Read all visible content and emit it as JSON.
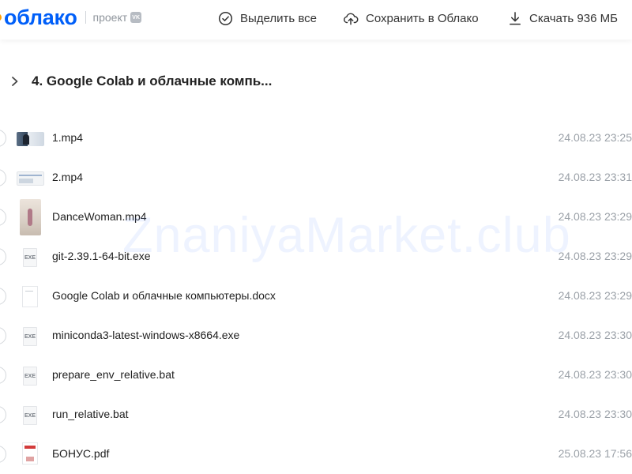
{
  "header": {
    "logo": "облако",
    "project_label": "проект",
    "vk_badge": "VK",
    "actions": {
      "select_all": "Выделить все",
      "save_to_cloud": "Сохранить в Облако",
      "download": "Скачать 936 МБ"
    }
  },
  "folder": {
    "title": "4. Google Colab и облачные компь..."
  },
  "files": [
    {
      "name": "1.mp4",
      "date": "24.08.23 23:25",
      "thumb": "video-thumbnail"
    },
    {
      "name": "2.mp4",
      "date": "24.08.23 23:31",
      "thumb": "video-thumbnail"
    },
    {
      "name": "DanceWoman.mp4",
      "date": "24.08.23 23:29",
      "thumb": "video-thumbnail"
    },
    {
      "name": "git-2.39.1-64-bit.exe",
      "date": "24.08.23 23:29",
      "thumb": "EXE"
    },
    {
      "name": "Google Colab и облачные компьютеры.docx",
      "date": "24.08.23 23:29",
      "thumb": "docx-thumbnail"
    },
    {
      "name": "miniconda3-latest-windows-x8664.exe",
      "date": "24.08.23 23:30",
      "thumb": "EXE"
    },
    {
      "name": "prepare_env_relative.bat",
      "date": "24.08.23 23:30",
      "thumb": "EXE"
    },
    {
      "name": "run_relative.bat",
      "date": "24.08.23 23:30",
      "thumb": "EXE"
    },
    {
      "name": "БОНУС.pdf",
      "date": "25.08.23 17:56",
      "thumb": "pdf-thumbnail"
    }
  ],
  "watermark": "ZnaniyaMarket.club",
  "colors": {
    "brand_blue": "#005ff9",
    "logo_dot": "#ff9e00",
    "date_gray": "#9ba1a8"
  }
}
